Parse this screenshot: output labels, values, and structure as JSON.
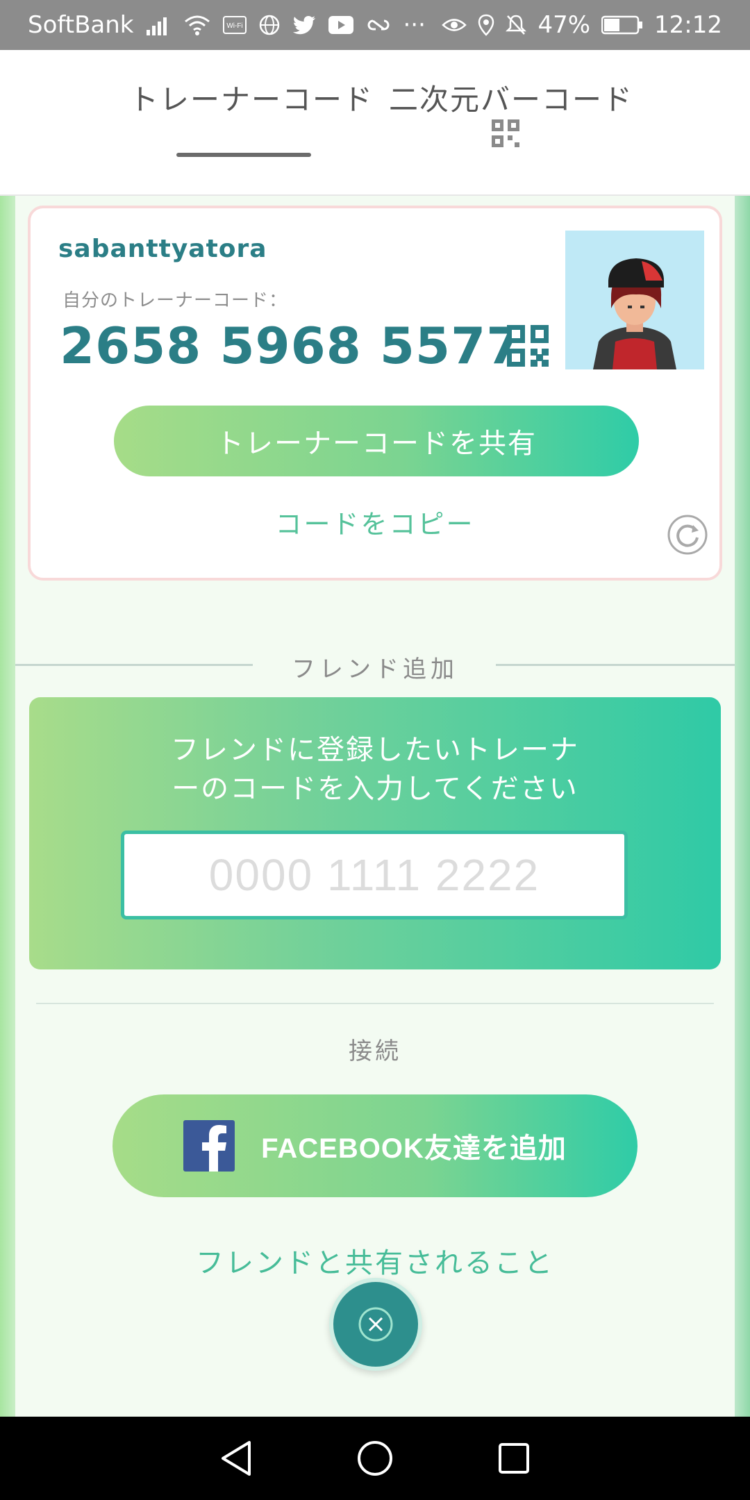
{
  "status_bar": {
    "carrier": "SoftBank",
    "battery_percent": "47%",
    "time": "12:12",
    "wifi_label": "Wi-Fi",
    "more": "···"
  },
  "tabs": {
    "trainer_code": "トレーナーコード",
    "qr_code": "二次元バーコード"
  },
  "card": {
    "username": "sabanttyatora",
    "code_label": "自分のトレーナーコード：",
    "code_value": "2658 5968 5577",
    "share_button": "トレーナーコードを共有",
    "copy_link": "コードをコピー"
  },
  "add_friend": {
    "section_title": "フレンド追加",
    "instruction_line1": "フレンドに登録したいトレーナ",
    "instruction_line2": "ーのコードを入力してください",
    "input_placeholder": "0000 1111 2222"
  },
  "connect": {
    "label": "接続",
    "facebook_button": "FACEBOOK友達を追加",
    "share_info_link": "フレンドと共有されること"
  },
  "colors": {
    "accent_teal": "#2b7e86",
    "accent_green": "#55c29a",
    "button_gradient_start": "#a6dc88",
    "button_gradient_end": "#2fcca7",
    "facebook_blue": "#3b5998"
  }
}
